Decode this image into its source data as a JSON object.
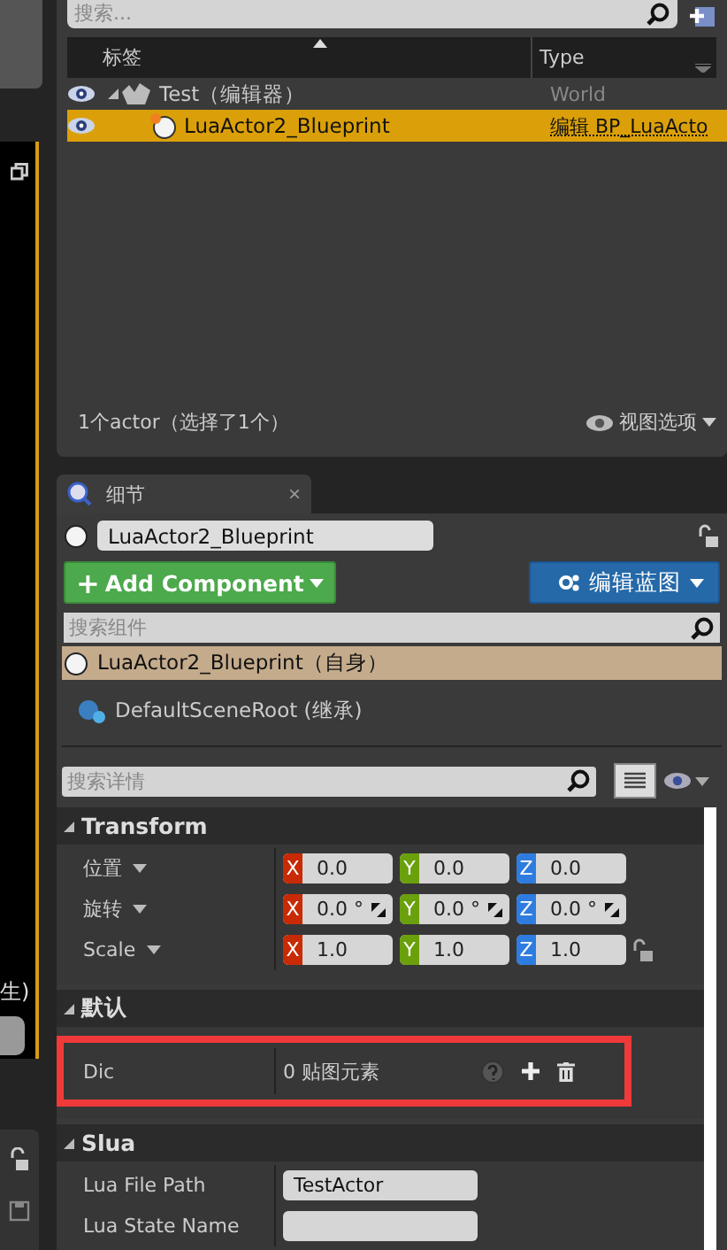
{
  "left_strip": {
    "cut_text": "生)"
  },
  "outliner": {
    "search": {
      "placeholder": "搜索..."
    },
    "columns": [
      {
        "label": "标签",
        "sorted": true
      },
      {
        "label": "Type",
        "sorted": false
      }
    ],
    "rows": [
      {
        "label": "Test（编辑器）",
        "type": "World",
        "kind": "world",
        "visible": true,
        "expanded": true,
        "selected": false
      },
      {
        "label": "LuaActor2_Blueprint",
        "type": "编辑 BP_LuaActo",
        "kind": "actor",
        "visible": true,
        "selected": true
      }
    ],
    "footer": "1个actor（选择了1个）",
    "view_options": "视图选项"
  },
  "details": {
    "tab": {
      "label": "细节",
      "close": "×"
    },
    "actor_name": "LuaActor2_Blueprint",
    "locked": false,
    "add_component": {
      "icon": "+",
      "label": "Add Component"
    },
    "edit_blueprint": "编辑蓝图",
    "component_search": {
      "placeholder": "搜索组件"
    },
    "components": [
      {
        "label": "LuaActor2_Blueprint（自身）",
        "kind": "actor",
        "selected": true
      },
      {
        "label": "DefaultSceneRoot (继承)",
        "kind": "scene",
        "selected": false
      }
    ],
    "details_search": {
      "placeholder": "搜索详情"
    },
    "sections": [
      {
        "title": "Transform",
        "expanded": true,
        "rows": [
          {
            "kind": "vector",
            "label": "位置",
            "axes": [
              "X",
              "Y",
              "Z"
            ],
            "values": [
              "0.0",
              "0.0",
              "0.0"
            ]
          },
          {
            "kind": "rotator",
            "label": "旋转",
            "axes": [
              "X",
              "Y",
              "Z"
            ],
            "values": [
              "0.0 °",
              "0.0 °",
              "0.0 °"
            ]
          },
          {
            "kind": "vector",
            "label": "Scale",
            "axes": [
              "X",
              "Y",
              "Z"
            ],
            "values": [
              "1.0",
              "1.0",
              "1.0"
            ],
            "lock": true
          }
        ]
      },
      {
        "title": "默认",
        "expanded": true,
        "rows": [
          {
            "kind": "map",
            "label": "Dic",
            "value": "0 贴图元素",
            "highlighted": true
          }
        ]
      },
      {
        "title": "Slua",
        "expanded": true,
        "rows": [
          {
            "kind": "text",
            "label": "Lua File Path",
            "value": "TestActor"
          },
          {
            "kind": "text",
            "label": "Lua State Name"
          }
        ]
      }
    ]
  }
}
